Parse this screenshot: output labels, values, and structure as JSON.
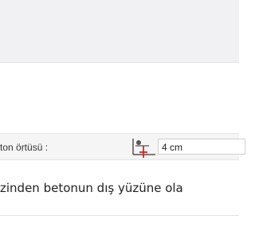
{
  "property": {
    "label": "ton örtüsü :",
    "icon": "concrete-cover-icon",
    "value": "4 cm"
  },
  "description": "zinden betonun dış yüzüne ola",
  "colors": {
    "header_bg": "#f1f1f3",
    "row_bg": "#f5f5f5",
    "icon_dark": "#555555",
    "icon_red": "#e02020"
  }
}
